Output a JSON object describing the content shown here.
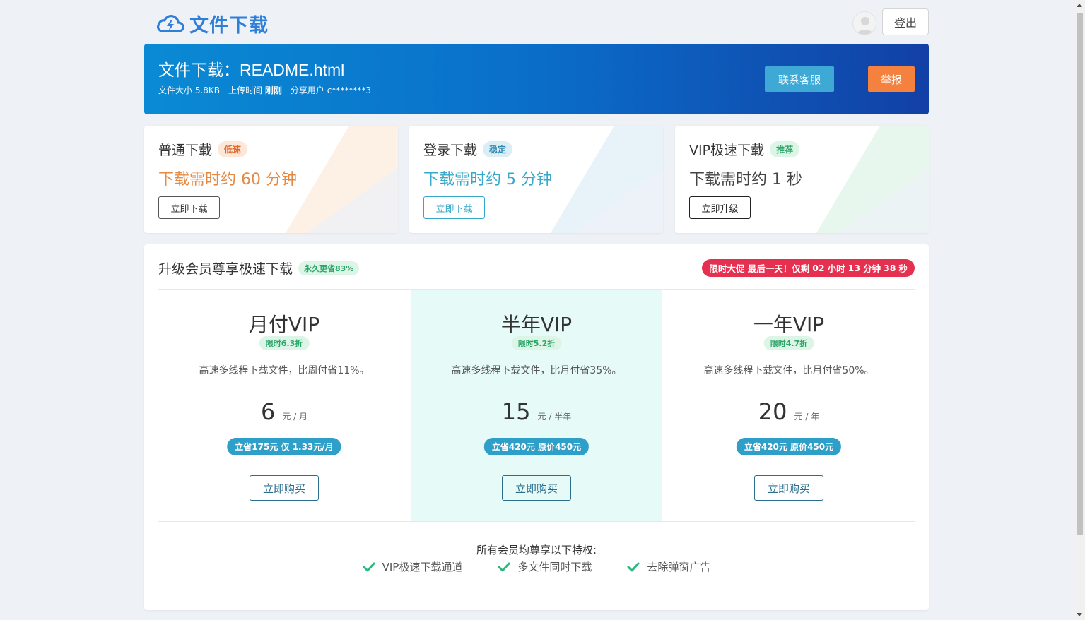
{
  "brand": {
    "logo_text": "文件下载"
  },
  "topbar": {
    "logout_label": "登出"
  },
  "file": {
    "title": "文件下载：README.html",
    "size_label": "文件大小",
    "size": "5.8KB",
    "time_label": "上传时间",
    "time": "刚刚",
    "user_label": "分享用户",
    "user": "c********3",
    "contact_label": "联系客服",
    "report_label": "举报"
  },
  "download_options": [
    {
      "title": "普通下载",
      "tag": "低速",
      "time": "下载需时约 60 分钟",
      "button": "立即下载",
      "color": "#e58a45"
    },
    {
      "title": "登录下载",
      "tag": "稳定",
      "time": "下载需时约 5 分钟",
      "button": "立即下载",
      "color": "#36a8c9"
    },
    {
      "title": "VIP极速下载",
      "tag": "推荐",
      "time": "下载需时约 1 秒",
      "button": "立即升级",
      "color": "#444444"
    }
  ],
  "vip": {
    "heading": "升级会员尊享极速下载",
    "heading_tag": "永久更省83%",
    "promo": {
      "prefix": "限时大促 最后一天！仅剩",
      "hours": "02",
      "h_unit": "小时",
      "minutes": "13",
      "m_unit": "分钟",
      "seconds": "38",
      "s_unit": "秒"
    },
    "plans": [
      {
        "name": "月付VIP",
        "tag": "限时6.3折",
        "desc": "高速多线程下载文件，比周付省11%。",
        "price": "6",
        "unit": "元 / 月",
        "save": "立省175元 仅 1.33元/月",
        "buy": "立即购买"
      },
      {
        "name": "半年VIP",
        "tag": "限时5.2折",
        "desc": "高速多线程下载文件，比月付省35%。",
        "price": "15",
        "unit": "元 / 半年",
        "save": "立省420元 原价450元",
        "buy": "立即购买"
      },
      {
        "name": "一年VIP",
        "tag": "限时4.7折",
        "desc": "高速多线程下载文件，比月付省50%。",
        "price": "20",
        "unit": "元 / 年",
        "save": "立省420元 原价450元",
        "buy": "立即购买"
      }
    ],
    "perks_title": "所有会员均尊享以下特权:",
    "perks": [
      "VIP极速下载通道",
      "多文件同时下载",
      "去除弹窗广告"
    ]
  }
}
